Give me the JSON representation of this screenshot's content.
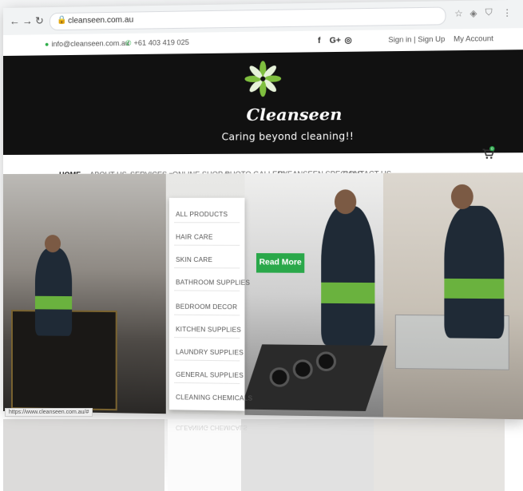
{
  "browser": {
    "url": "cleanseen.com.au",
    "status_url": "https://www.cleanseen.com.au/#"
  },
  "topbar": {
    "email": "info@cleanseen.com.au",
    "phone": "+61 403 419 025",
    "social": [
      "f",
      "G+",
      "◎"
    ],
    "sign_in": "Sign in",
    "separator": "|",
    "sign_up": "Sign Up",
    "my_account": "My Account"
  },
  "header": {
    "logo": "Cleanseen",
    "tagline": "Caring beyond cleaning!!",
    "logo_color": "#7fbf3f"
  },
  "nav": {
    "items": [
      "HOME",
      "ABOUT US",
      "SERVICES ▾",
      "ONLINE SHOP ▾",
      "PHOTO GALLERY",
      "CLEANSEEN SPECIALS",
      "CONTACT US"
    ],
    "cart_count": "0"
  },
  "dropdown": {
    "items": [
      "ALL PRODUCTS",
      "HAIR CARE",
      "SKIN CARE",
      "BATHROOM SUPPLIES",
      "BEDROOM DECOR",
      "KITCHEN SUPPLIES",
      "LAUNDRY SUPPLIES",
      "GENERAL SUPPLIES",
      "CLEANING CHEMICALS"
    ]
  },
  "hero": {
    "cta": "Read More",
    "cta_color": "#2aa84a"
  },
  "reflection": {
    "text": "CLEANING CHEMICALS"
  }
}
